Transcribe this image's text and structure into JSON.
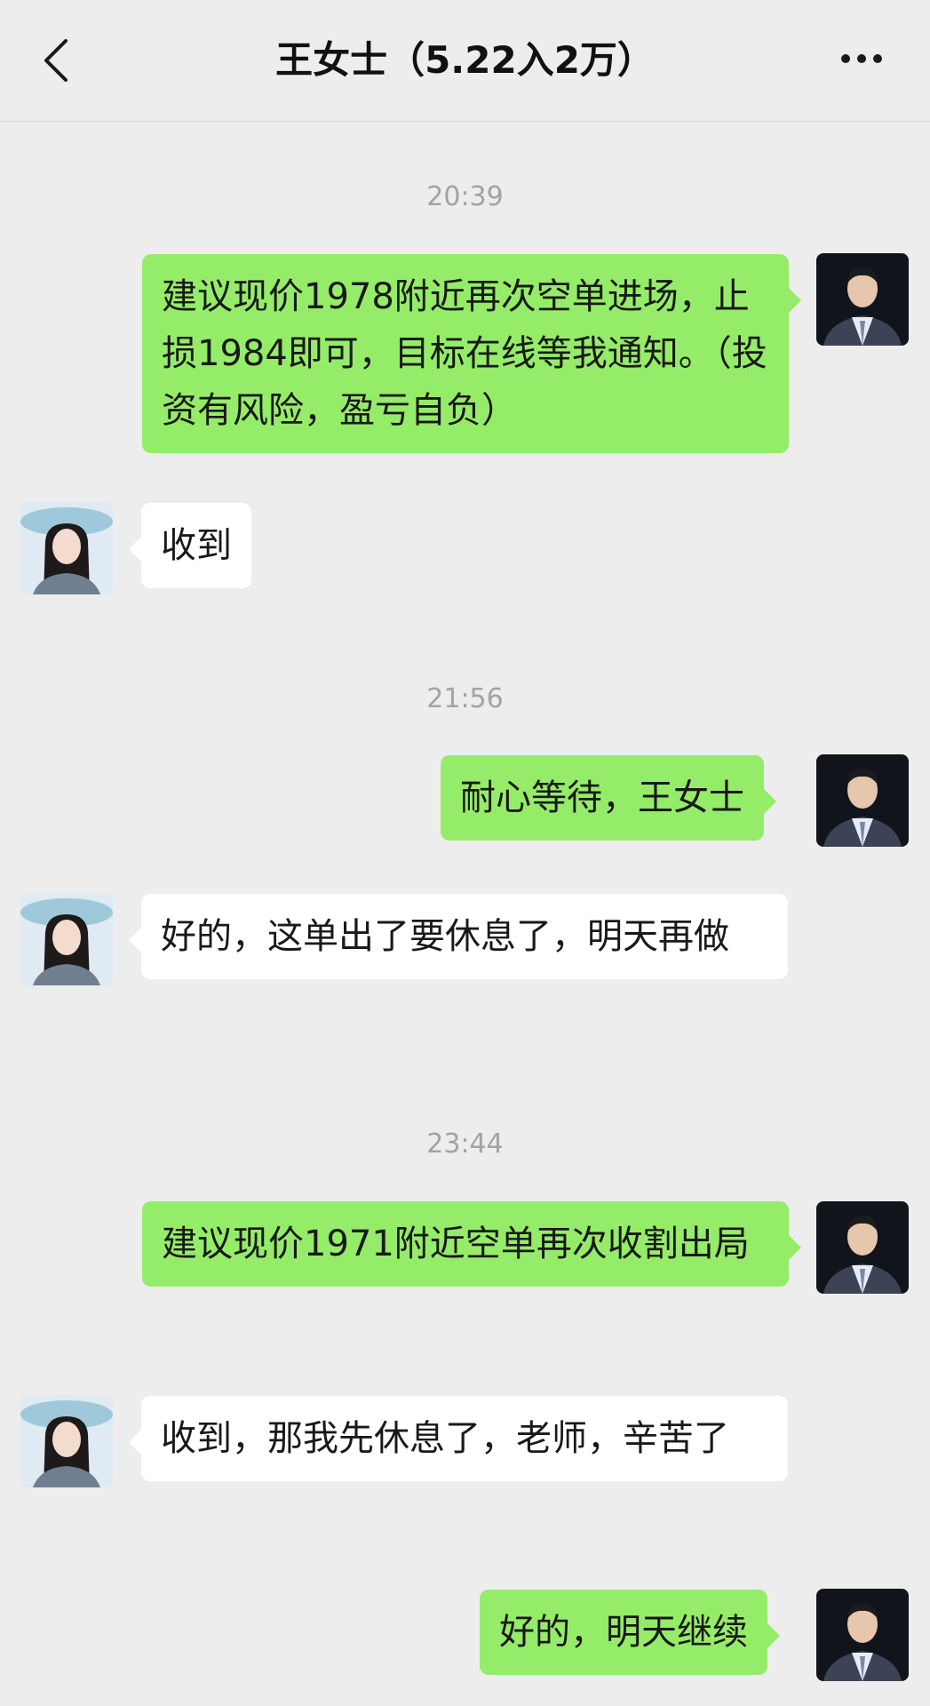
{
  "header": {
    "title": "王女士（5.22入2万）",
    "back_icon": "chevron-left-icon",
    "more_icon": "more-dots-icon"
  },
  "messages": [
    {
      "type": "time",
      "text": "20:39"
    },
    {
      "type": "msg",
      "side": "self",
      "text": "建议现价1978附近再次空单进场，止损1984即可，目标在线等我通知。（投资有风险，盈亏自负）"
    },
    {
      "type": "msg",
      "side": "other",
      "text": "收到"
    },
    {
      "type": "time",
      "text": "21:56"
    },
    {
      "type": "msg",
      "side": "self",
      "text": "耐心等待，王女士"
    },
    {
      "type": "msg",
      "side": "other",
      "text": "好的，这单出了要休息了，明天再做"
    },
    {
      "type": "time",
      "text": "23:44"
    },
    {
      "type": "msg",
      "side": "self",
      "text": "建议现价1971附近空单再次收割出局"
    },
    {
      "type": "msg",
      "side": "other",
      "text": "收到，那我先休息了，老师，辛苦了"
    },
    {
      "type": "msg",
      "side": "self",
      "text": "好的，明天继续"
    }
  ],
  "colors": {
    "background": "#ededed",
    "self_bubble": "#95ec69",
    "other_bubble": "#ffffff",
    "timestamp": "#a3a3a3"
  }
}
